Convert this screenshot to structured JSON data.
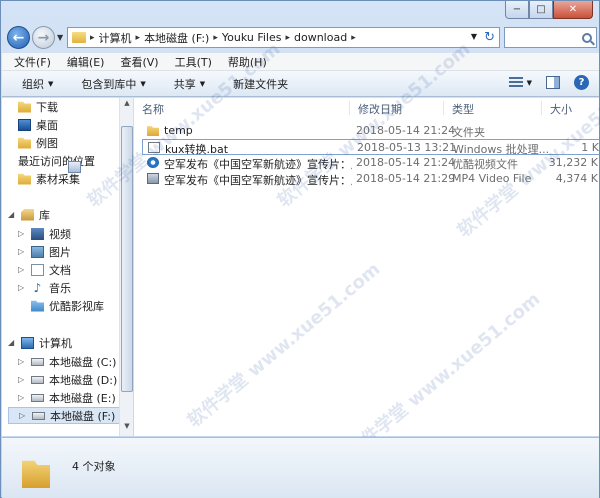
{
  "window": {
    "caption": {
      "minimize": "−",
      "maximize": "□",
      "close": "✕"
    }
  },
  "address": {
    "crumbs": [
      "计算机",
      "本地磁盘 (F:)",
      "Youku Files",
      "download"
    ]
  },
  "menu": [
    "文件(F)",
    "编辑(E)",
    "查看(V)",
    "工具(T)",
    "帮助(H)"
  ],
  "toolbar": {
    "organize": "组织",
    "include": "包含到库中",
    "share": "共享",
    "new_folder": "新建文件夹"
  },
  "sidebar": {
    "favorites": [
      {
        "label": "下载",
        "icon": "download-icon"
      },
      {
        "label": "桌面",
        "icon": "desktop-icon"
      },
      {
        "label": "例图",
        "icon": "folder-icon"
      },
      {
        "label": "最近访问的位置",
        "icon": "recent-icon"
      },
      {
        "label": "素材采集",
        "icon": "folder-icon"
      }
    ],
    "library_label": "库",
    "libraries": [
      {
        "label": "视频",
        "icon": "video-icon"
      },
      {
        "label": "图片",
        "icon": "picture-icon"
      },
      {
        "label": "文档",
        "icon": "document-icon"
      },
      {
        "label": "音乐",
        "icon": "music-icon"
      },
      {
        "label": "优酷影视库",
        "icon": "youku-icon"
      }
    ],
    "computer_label": "计算机",
    "drives": [
      {
        "label": "本地磁盘 (C:)"
      },
      {
        "label": "本地磁盘 (D:)"
      },
      {
        "label": "本地磁盘 (E:)"
      },
      {
        "label": "本地磁盘 (F:)"
      }
    ]
  },
  "columns": {
    "name": "名称",
    "date": "修改日期",
    "type": "类型",
    "size": "大小"
  },
  "files": [
    {
      "name": "temp",
      "date": "2018-05-14 21:24",
      "type": "文件夹",
      "size": "",
      "icon": "folder-icon"
    },
    {
      "name": "kux转换.bat",
      "date": "2018-05-13 13:21",
      "type": "Windows 批处理...",
      "size": "1 K",
      "icon": "bat-file-icon"
    },
    {
      "name": "空军发布《中国空军新航迹》宣传片：展...",
      "date": "2018-05-14 21:24",
      "type": "优酷视频文件",
      "size": "31,232 K",
      "icon": "youku-video-icon"
    },
    {
      "name": "空军发布《中国空军新航迹》宣传片：展...",
      "date": "2018-05-14 21:29",
      "type": "MP4 Video File",
      "size": "4,374 K",
      "icon": "mp4-file-icon"
    }
  ],
  "status": {
    "count": "4 个对象"
  },
  "watermark": "软件学堂 www.xue51.com"
}
